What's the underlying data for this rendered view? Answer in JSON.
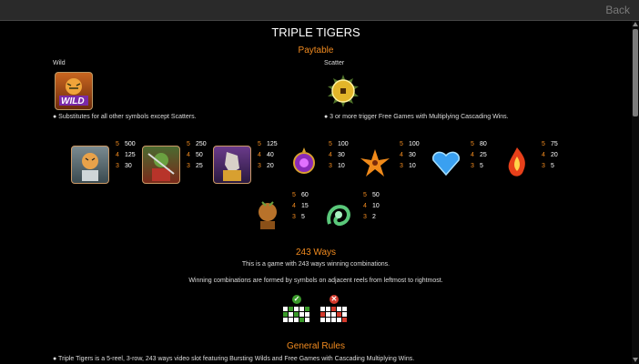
{
  "nav": {
    "back_label": "Back"
  },
  "title": "TRIPLE TIGERS",
  "paytable": {
    "heading": "Paytable",
    "wild": {
      "label": "Wild",
      "icon_text": "WILD",
      "description": "● Substitutes for all other symbols except Scatters."
    },
    "scatter": {
      "label": "Scatter",
      "description": "● 3 or more trigger Free Games with Multiplying Cascading Wins."
    },
    "row1": [
      {
        "icon": "tiger-warrior-icon",
        "pays": [
          [
            "5",
            "500"
          ],
          [
            "4",
            "125"
          ],
          [
            "3",
            "30"
          ]
        ]
      },
      {
        "icon": "turtle-warrior-icon",
        "pays": [
          [
            "5",
            "250"
          ],
          [
            "4",
            "50"
          ],
          [
            "3",
            "25"
          ]
        ]
      },
      {
        "icon": "horse-warrior-icon",
        "pays": [
          [
            "5",
            "125"
          ],
          [
            "4",
            "40"
          ],
          [
            "3",
            "20"
          ]
        ]
      },
      {
        "icon": "purple-orb-icon",
        "pays": [
          [
            "5",
            "100"
          ],
          [
            "4",
            "30"
          ],
          [
            "3",
            "10"
          ]
        ]
      },
      {
        "icon": "orange-lily-icon",
        "pays": [
          [
            "5",
            "100"
          ],
          [
            "4",
            "30"
          ],
          [
            "3",
            "10"
          ]
        ]
      },
      {
        "icon": "blue-heart-gem-icon",
        "pays": [
          [
            "5",
            "80"
          ],
          [
            "4",
            "25"
          ],
          [
            "3",
            "5"
          ]
        ]
      },
      {
        "icon": "fire-gem-icon",
        "pays": [
          [
            "5",
            "75"
          ],
          [
            "4",
            "20"
          ],
          [
            "3",
            "5"
          ]
        ]
      }
    ],
    "row2": [
      {
        "icon": "bronze-tiger-statue-icon",
        "pays": [
          [
            "5",
            "60"
          ],
          [
            "4",
            "15"
          ],
          [
            "3",
            "5"
          ]
        ]
      },
      {
        "icon": "jade-dragon-icon",
        "pays": [
          [
            "5",
            "50"
          ],
          [
            "4",
            "10"
          ],
          [
            "3",
            "2"
          ]
        ]
      }
    ]
  },
  "ways": {
    "heading": "243 Ways",
    "line1": "This is a game with 243 ways winning combinations.",
    "line2": "Winning combinations are formed by symbols on adjacent reels from leftmost to rightmost."
  },
  "rules": {
    "heading": "General Rules",
    "line1": "● Triple Tigers is a 5-reel, 3-row, 243 ways video slot featuring Bursting Wilds and Free Games with Cascading Multiplying Wins."
  },
  "colors": {
    "accent": "#f28b1f",
    "valid": "#3a9a2a",
    "invalid": "#d33a2c",
    "bg": "#000000"
  }
}
